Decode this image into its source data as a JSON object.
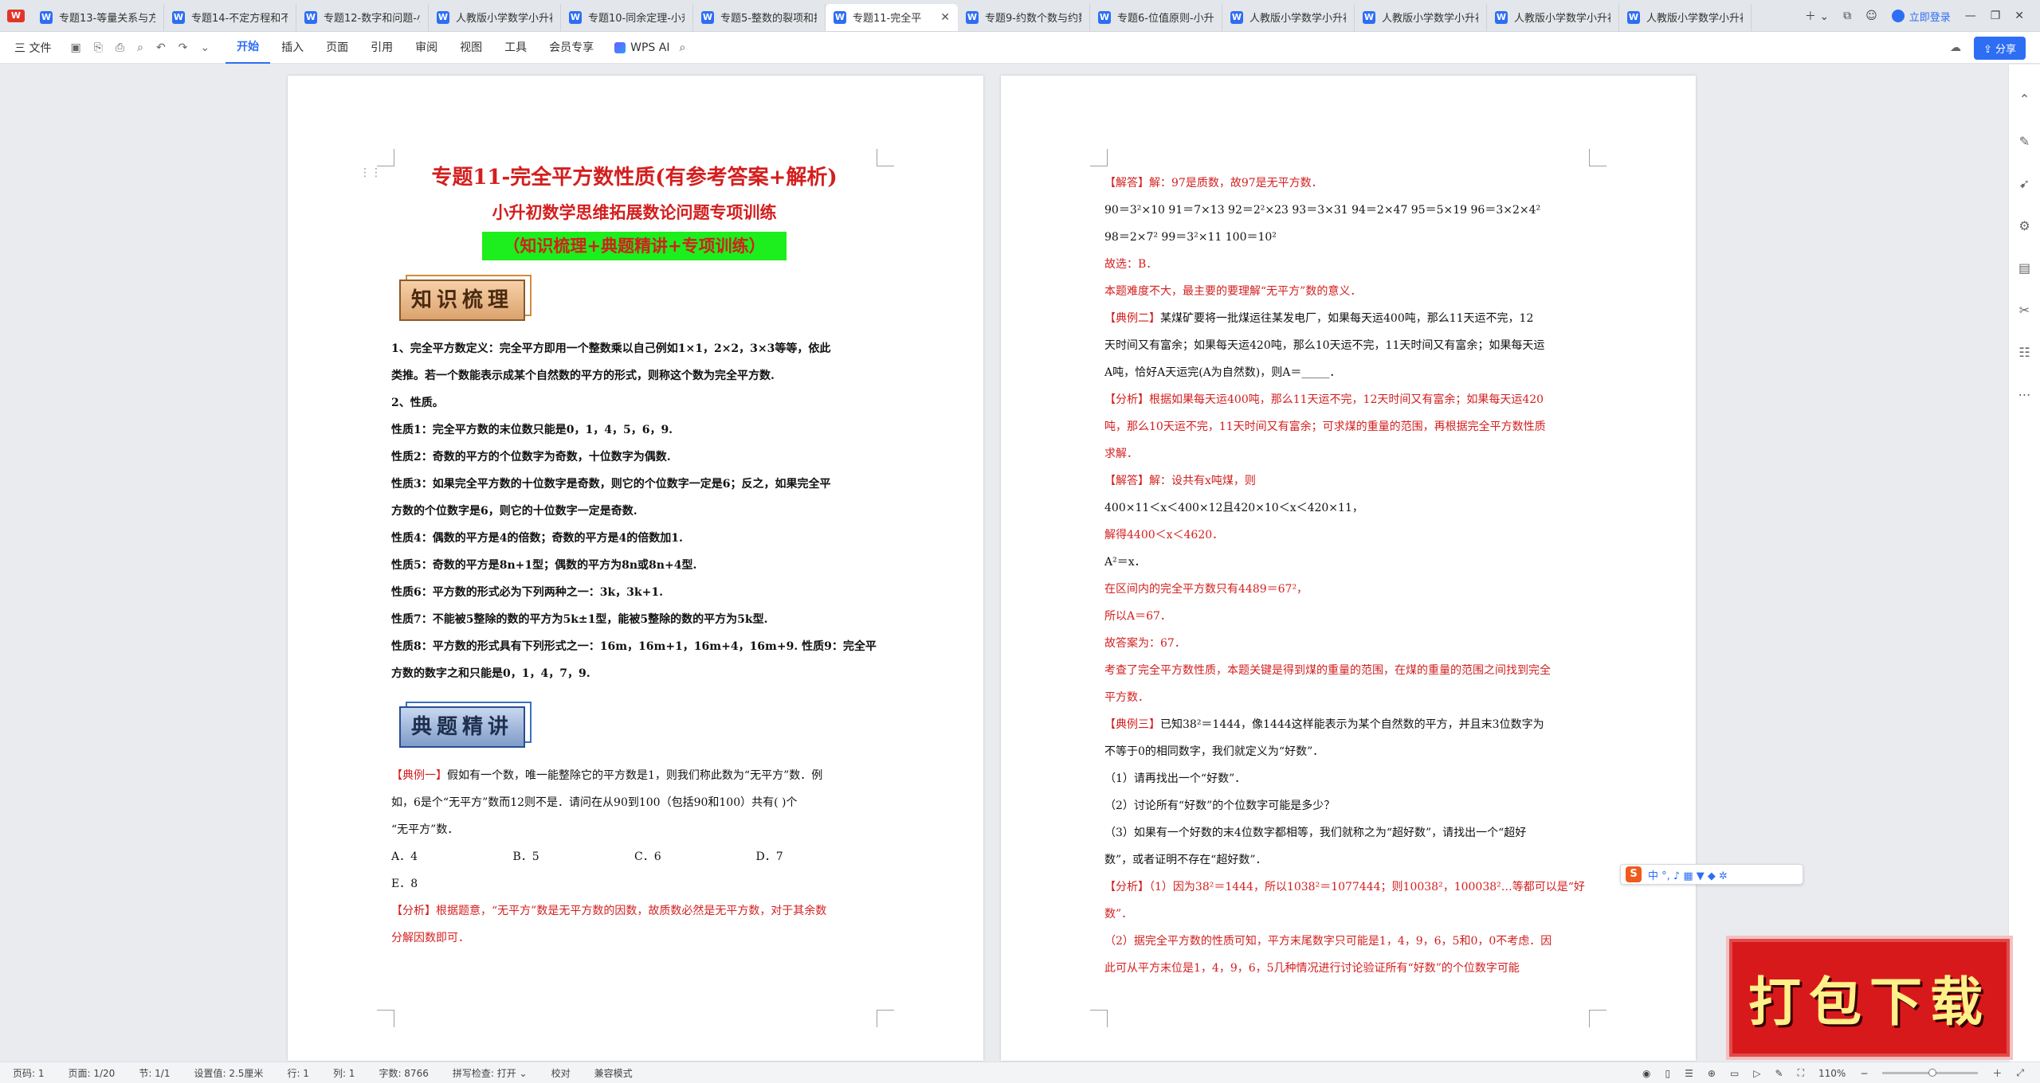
{
  "app": {
    "logo": "W"
  },
  "tabs": [
    {
      "title": "专题13-等量关系与方",
      "active": false
    },
    {
      "title": "专题14-不定方程和不",
      "active": false
    },
    {
      "title": "专题12-数字和问题-小",
      "active": false
    },
    {
      "title": "人教版小学数学小升初",
      "active": false
    },
    {
      "title": "专题10-同余定理-小升",
      "active": false
    },
    {
      "title": "专题5-整数的裂项和拆",
      "active": false
    },
    {
      "title": "专题11-完全平",
      "active": true
    },
    {
      "title": "专题9-约数个数与约数",
      "active": false
    },
    {
      "title": "专题6-位值原则-小升",
      "active": false
    },
    {
      "title": "人教版小学数学小升初",
      "active": false
    },
    {
      "title": "人教版小学数学小升初",
      "active": false
    },
    {
      "title": "人教版小学数学小升初",
      "active": false
    },
    {
      "title": "人教版小学数学小升初",
      "active": false
    }
  ],
  "login_label": "立即登录",
  "menu": {
    "file": "三 文件",
    "items": [
      "开始",
      "插入",
      "页面",
      "引用",
      "审阅",
      "视图",
      "工具",
      "会员专享"
    ],
    "wps_ai": "WPS AI",
    "share": "分享"
  },
  "page1": {
    "title1": "专题11-完全平方数性质(有参考答案+解析)",
    "title2": "小升初数学思维拓展数论问题专项训练",
    "title3": "（知识梳理+典题精讲+专项训练）",
    "section1": "知识梳理",
    "lines": [
      "1、完全平方数定义：完全平方即用一个整数乘以自己例如1×1，2×2，3×3等等，依此",
      "类推。若一个数能表示成某个自然数的平方的形式，则称这个数为完全平方数.",
      "2、性质。",
      "性质1：完全平方数的末位数只能是0，1，4，5，6，9.",
      "性质2：奇数的平方的个位数字为奇数，十位数字为偶数.",
      "性质3：如果完全平方数的十位数字是奇数，则它的个位数字一定是6；反之，如果完全平",
      "方数的个位数字是6，则它的十位数字一定是奇数.",
      "性质4：偶数的平方是4的倍数；奇数的平方是4的倍数加1.",
      "性质5：奇数的平方是8n+1型；偶数的平方为8n或8n+4型.",
      "性质6：平方数的形式必为下列两种之一：3k，3k+1.",
      "性质7：不能被5整除的数的平方为5k±1型，能被5整除的数的平方为5k型.",
      "性质8：平方数的形式具有下列形式之一：16m，16m+1，16m+4，16m+9.  性质9：完全平",
      "方数的数字之和只能是0，1，4，7，9."
    ],
    "section2": "典题精讲",
    "ex1_label": "【典例一】",
    "ex1_lines": [
      "假如有一个数，唯一能整除它的平方数是1，则我们称此数为“无平方”数．例",
      "如，6是个“无平方”数而12则不是．请问在从90到100（包括90和100）共有(      )个",
      "“无平方”数．"
    ],
    "options": [
      "A．4",
      "B．5",
      "C．6",
      "D．7"
    ],
    "option_e": "E．8",
    "analysis_lines": [
      "【分析】根据题意，“无平方”数是无平方数的因数，故质数必然是无平方数，对于其余数",
      "分解因数即可．"
    ]
  },
  "page2": {
    "lines": [
      {
        "c": "r",
        "t": "【解答】解：97是质数，故97是无平方数．"
      },
      {
        "c": "b",
        "t": "90＝3²×10 91＝7×13 92＝2²×23 93＝3×31 94＝2×47 95＝5×19 96＝3×2×4²"
      },
      {
        "c": "b",
        "t": "98＝2×7² 99＝3²×11 100＝10²"
      },
      {
        "c": "r",
        "t": "故选：B．"
      },
      {
        "c": "r",
        "t": "本题难度不大，最主要的要理解“无平方”数的意义．"
      },
      {
        "c": "m",
        "l": "【典例二】",
        "t": "某煤矿要将一批煤运往某发电厂，如果每天运400吨，那么11天运不完，12"
      },
      {
        "c": "b",
        "t": "天时间又有富余；如果每天运420吨，那么10天运不完，11天时间又有富余；如果每天运"
      },
      {
        "c": "b",
        "t": "A吨，恰好A天运完(A为自然数)，则A＝_____．"
      },
      {
        "c": "r",
        "t": "【分析】根据如果每天运400吨，那么11天运不完，12天时间又有富余；如果每天运420"
      },
      {
        "c": "r",
        "t": "吨，那么10天运不完，11天时间又有富余；可求煤的重量的范围，再根据完全平方数性质"
      },
      {
        "c": "r",
        "t": "求解．"
      },
      {
        "c": "r",
        "t": "【解答】解：设共有x吨煤，则"
      },
      {
        "c": "b",
        "t": "400×11＜x＜400×12且420×10＜x＜420×11，"
      },
      {
        "c": "r",
        "t": "解得4400＜x＜4620．"
      },
      {
        "c": "b",
        "t": "A²＝x．"
      },
      {
        "c": "r",
        "t": "在区间内的完全平方数只有4489＝67²，"
      },
      {
        "c": "r",
        "t": "所以A＝67．"
      },
      {
        "c": "r",
        "t": "故答案为：67．"
      },
      {
        "c": "r",
        "t": "考查了完全平方数性质，本题关键是得到煤的重量的范围，在煤的重量的范围之间找到完全"
      },
      {
        "c": "r",
        "t": "平方数．"
      },
      {
        "c": "m",
        "l": "【典例三】",
        "t": "已知38²＝1444，像1444这样能表示为某个自然数的平方，并且末3位数字为"
      },
      {
        "c": "b",
        "t": "不等于0的相同数字，我们就定义为“好数”．"
      },
      {
        "c": "b",
        "t": "（1）请再找出一个“好数”．"
      },
      {
        "c": "b",
        "t": "（2）讨论所有“好数”的个位数字可能是多少？"
      },
      {
        "c": "b",
        "t": "（3）如果有一个好数的末4位数字都相等，我们就称之为“超好数”，请找出一个“超好"
      },
      {
        "c": "b",
        "t": "数”，或者证明不存在“超好数”．"
      },
      {
        "c": "r",
        "t": "【分析】（1）因为38²＝1444，所以1038²＝1077444；则10038²，100038²…等都可以是“好"
      },
      {
        "c": "r",
        "t": "数”．"
      },
      {
        "c": "r",
        "t": "（2）据完全平方数的性质可知，平方末尾数字只可能是1，4，9，6，5和0，0不考虑．因"
      },
      {
        "c": "r",
        "t": "此可从平方末位是1，4，9，6，5几种情况进行讨论验证所有“好数”的个位数字可能"
      }
    ]
  },
  "ime": {
    "logo": "S",
    "text": "中 °, ♪ ▦ ▼ ◆ ✲"
  },
  "download_banner": "打包下载",
  "status": {
    "page_num": "页码: 1",
    "pages": "页面: 1/20",
    "section": "节: 1/1",
    "setting": "设置值: 2.5厘米",
    "row": "行: 1",
    "col": "列: 1",
    "words": "字数: 8766",
    "spell": "拼写检查: 打开 ⌄",
    "proof": "校对",
    "compat": "兼容模式",
    "zoom": "110%",
    "zoom_fraction": 0.52
  }
}
